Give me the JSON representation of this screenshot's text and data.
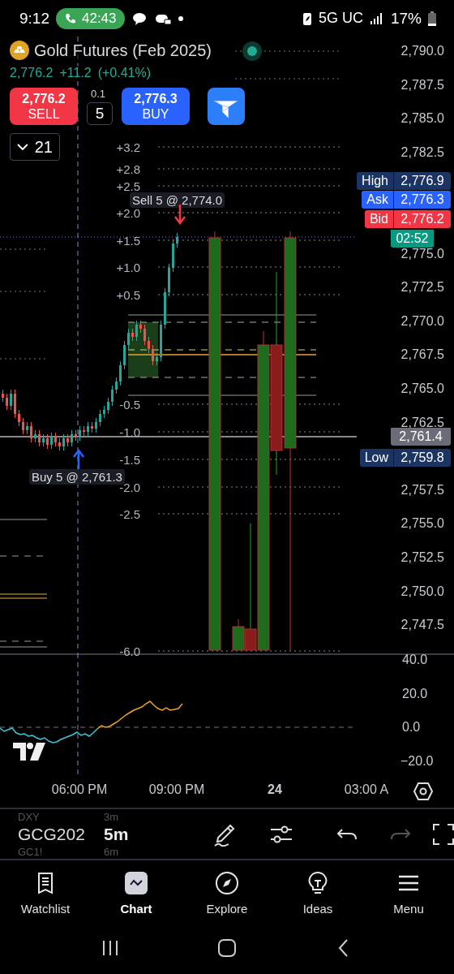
{
  "status_bar": {
    "time": "9:12",
    "call_timer": "42:43",
    "network": "5G UC",
    "battery": "17%"
  },
  "symbol": {
    "name": "Gold Futures (Feb 2025)",
    "price": "2,776.2",
    "change": "+11.2",
    "change_percent": "(+0.41%)"
  },
  "order_panel": {
    "sell_price": "2,776.2",
    "sell_label": "SELL",
    "step": "0.1",
    "quantity": "5",
    "buy_price": "2,776.3",
    "buy_label": "BUY"
  },
  "indicators_button": {
    "count": "21"
  },
  "level_labels": [
    "+3.2",
    "+2.8",
    "+2.5",
    "+2.0",
    "+1.5",
    "+1.0",
    "+0.5",
    "-0.5",
    "-1.0",
    "-1.5",
    "-2.0",
    "-2.5",
    "-6.0"
  ],
  "price_axis": [
    "2,790.0",
    "2,787.5",
    "2,785.0",
    "2,782.5",
    "2,775.0",
    "2,772.5",
    "2,770.0",
    "2,767.5",
    "2,765.0",
    "2,762.5",
    "2,757.5",
    "2,755.0",
    "2,752.5",
    "2,750.0",
    "2,747.5"
  ],
  "price_tags": [
    {
      "kind": "high",
      "label": "High",
      "value": "2,776.9"
    },
    {
      "kind": "ask",
      "label": "Ask",
      "value": "2,776.3"
    },
    {
      "kind": "bid",
      "label": "Bid",
      "value": "2,776.2"
    },
    {
      "kind": "countdown",
      "value": "02:52"
    },
    {
      "kind": "crosshair",
      "value": "2,761.4"
    },
    {
      "kind": "low",
      "label": "Low",
      "value": "2,759.8"
    }
  ],
  "trade_markers": [
    {
      "kind": "sell",
      "text": "Sell 5 @ 2,774.0"
    },
    {
      "kind": "buy",
      "text": "Buy 5 @ 2,761.3"
    }
  ],
  "oscillator_axis": [
    "40.0",
    "20.0",
    "0.0",
    "−20.0"
  ],
  "time_axis": [
    {
      "kind": "time",
      "text": "06:00 PM"
    },
    {
      "kind": "time",
      "text": "09:00 PM"
    },
    {
      "kind": "day",
      "text": "24"
    },
    {
      "kind": "time",
      "text": "03:00 A"
    }
  ],
  "toolbar": {
    "symbol": "GCG202",
    "interval": "5m",
    "picker_above": {
      "symbol": "DXY",
      "interval": "3m"
    },
    "picker_below": {
      "symbol": "GC1!",
      "interval": "6m"
    },
    "tools": [
      {
        "kind": "draw",
        "disabled": false
      },
      {
        "kind": "settings",
        "disabled": false
      },
      {
        "kind": "undo",
        "disabled": false
      },
      {
        "kind": "redo",
        "disabled": true
      },
      {
        "kind": "fullscreen",
        "disabled": false
      }
    ]
  },
  "nav_tabs": [
    {
      "kind": "watchlist",
      "label": "Watchlist",
      "selected": false
    },
    {
      "kind": "chart",
      "label": "Chart",
      "selected": true
    },
    {
      "kind": "explore",
      "label": "Explore",
      "selected": false
    },
    {
      "kind": "ideas",
      "label": "Ideas",
      "selected": false
    },
    {
      "kind": "menu",
      "label": "Menu",
      "selected": false
    }
  ]
}
